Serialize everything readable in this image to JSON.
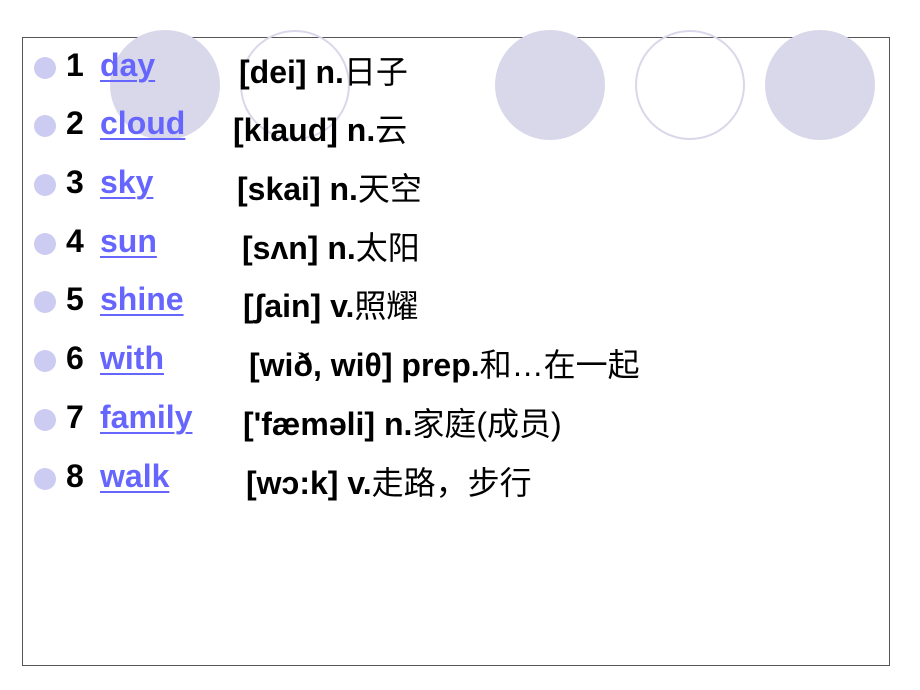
{
  "colors": {
    "link": "#6666ff",
    "bullet": "#ccccf2",
    "circle": "#d8d8ea"
  },
  "items": [
    {
      "num": "1",
      "word": "day",
      "phon": "[dei] n.",
      "cn": "日子"
    },
    {
      "num": "2",
      "word": "cloud",
      "phon": "[klaud] n.",
      "cn": "云"
    },
    {
      "num": "3",
      "word": "sky",
      "phon": "[skai] n.",
      "cn": "天空"
    },
    {
      "num": "4",
      "word": "sun",
      "phon": "[sʌn] n.",
      "cn": "太阳"
    },
    {
      "num": "5",
      "word": "shine",
      "phon": "[ʃain] v.",
      "cn": "照耀"
    },
    {
      "num": "6",
      "word": "with",
      "phon": "[wið, wiθ] prep.",
      "cn": "和…在一起"
    },
    {
      "num": "7",
      "word": "family",
      "phon": "['fæməli] n.",
      "cn": "家庭(成员)"
    },
    {
      "num": "8",
      "word": "walk",
      "phon": "[wɔ:k] v.",
      "cn": "走路，步行"
    }
  ]
}
